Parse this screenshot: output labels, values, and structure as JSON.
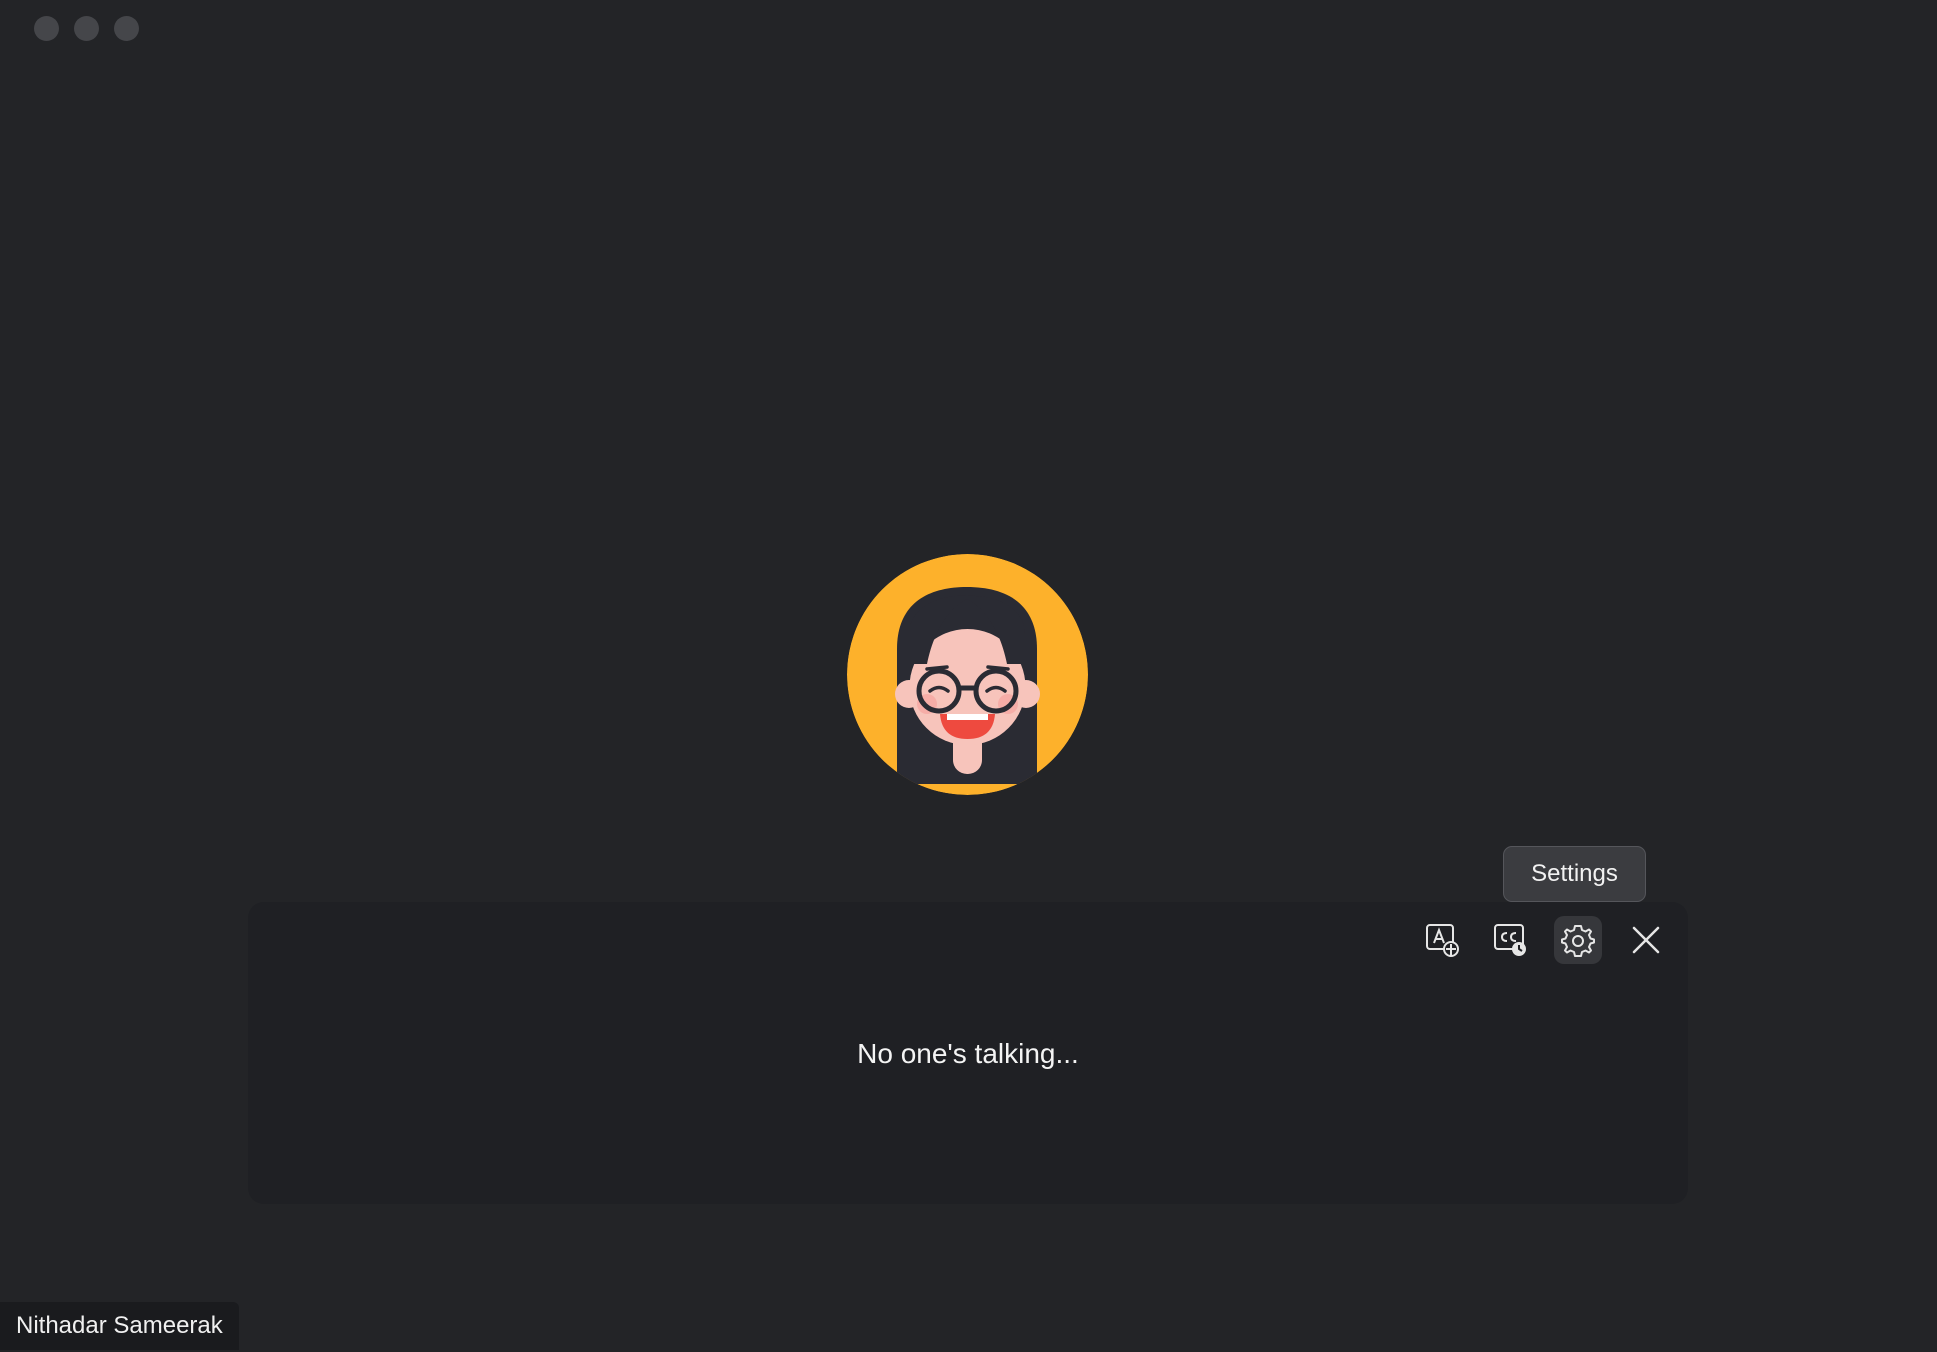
{
  "window": {
    "controls": [
      "close",
      "minimize",
      "zoom"
    ]
  },
  "participant": {
    "avatar_icon": "woman-with-glasses-avatar",
    "avatar_bg": "#FDB12B",
    "name": "Nithadar Sameerak"
  },
  "tooltip": {
    "text": "Settings"
  },
  "captions_panel": {
    "status_text": "No one's talking...",
    "toolbar": {
      "icons": [
        "translate-icon",
        "caption-history-icon",
        "gear-icon",
        "close-icon"
      ]
    }
  }
}
